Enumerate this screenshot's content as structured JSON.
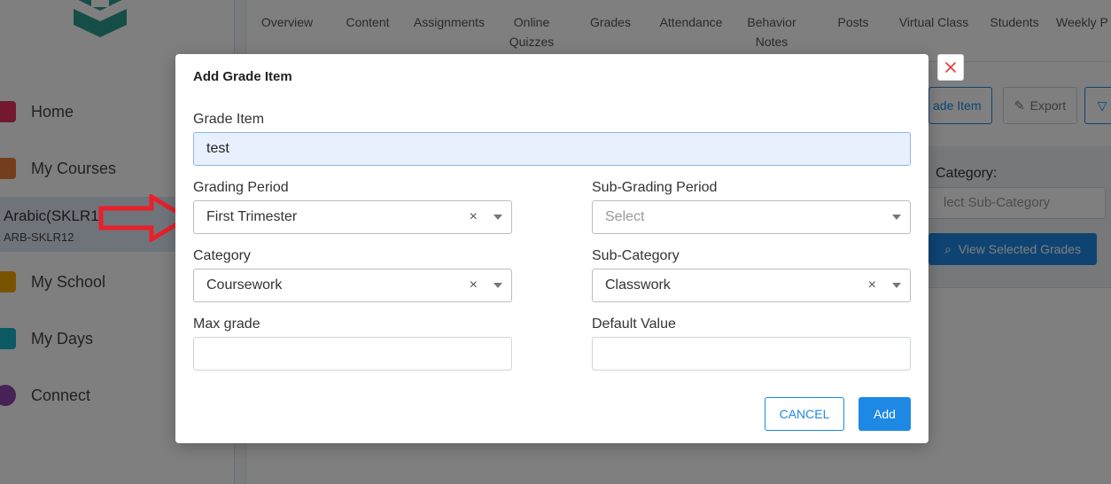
{
  "sidebar": {
    "items": [
      {
        "label": "Home",
        "icon": "home-icon",
        "color": "#e5325e"
      },
      {
        "label": "My Courses",
        "icon": "books-icon",
        "color": "#e87a3a"
      },
      {
        "label": "My School",
        "icon": "school-icon",
        "color": "#f2a900"
      },
      {
        "label": "My Days",
        "icon": "calendar-icon",
        "color": "#19b3c6"
      },
      {
        "label": "Connect",
        "icon": "chat-icon",
        "color": "#8e44ad"
      }
    ],
    "active_course": {
      "name": "Arabic(SKLR1",
      "code": "ARB-SKLR12"
    }
  },
  "tabs": [
    {
      "label": "Overview"
    },
    {
      "label": "Content"
    },
    {
      "label": "Assignments"
    },
    {
      "label": "Online\nQuizzes"
    },
    {
      "label": "Grades"
    },
    {
      "label": "Attendance"
    },
    {
      "label": "Behavior\nNotes"
    },
    {
      "label": "Posts"
    },
    {
      "label": "Virtual Class"
    },
    {
      "label": "Students"
    },
    {
      "label": "Weekly P"
    }
  ],
  "toolbar": {
    "add_grade_item_label": "ade Item",
    "export_label": "Export",
    "filter_icon": "filter-icon"
  },
  "filter_panel": {
    "subcategory_label": "Category:",
    "subcategory_placeholder": "lect Sub-Category",
    "view_button_label": "View Selected Grades"
  },
  "modal": {
    "title": "Add Grade Item",
    "grade_item": {
      "label": "Grade Item",
      "value": "test"
    },
    "grading_period": {
      "label": "Grading Period",
      "value": "First Trimester"
    },
    "sub_grading_period": {
      "label": "Sub-Grading Period",
      "placeholder": "Select"
    },
    "category": {
      "label": "Category",
      "value": "Coursework"
    },
    "sub_category": {
      "label": "Sub-Category",
      "value": "Classwork"
    },
    "max_grade": {
      "label": "Max grade",
      "value": ""
    },
    "default_value": {
      "label": "Default Value",
      "value": ""
    },
    "cancel_label": "CANCEL",
    "add_label": "Add",
    "clear_glyph": "×"
  },
  "colors": {
    "accent": "#1e88e5",
    "annotation_arrow": "#e8202a",
    "close_x": "#e53935"
  }
}
